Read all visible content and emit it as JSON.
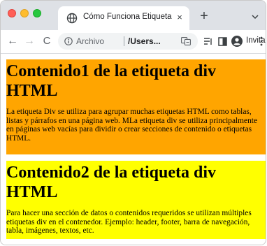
{
  "browser": {
    "tab": {
      "title": "Cómo Funciona Etiqueta DIV",
      "close": "×"
    },
    "new_tab": "+",
    "toolbar": {
      "back": "←",
      "forward": "→",
      "reload": "C",
      "site_info_label": "Archivo",
      "url": "/Users...",
      "profile_label": "Invitado"
    }
  },
  "page": {
    "blocks": [
      {
        "heading": "Contenido1 de la etiqueta div HTML",
        "text": "La etiqueta Div se utiliza para agrupar muchas etiquetas HTML como tablas, listas y párrafos en una página web. MLa etiqueta div se utiliza principalmente en páginas web vacías para dividir o crear secciones de contenido o etiquetas HTML.",
        "background": "#ffa500"
      },
      {
        "heading": "Contenido2 de la etiqueta div HTML",
        "text": "Para hacer una sección de datos o contenidos requeridos se utilizan múltiples etiquetas div en el contenedor. Ejemplo: header, footer, barra de navegación, tabla, imágenes, textos, etc.",
        "background": "#ffff00"
      }
    ]
  },
  "colors": {
    "close": "#ff5f57",
    "minimize": "#febc2e",
    "maximize": "#28c840",
    "tab_strip": "#dee1e6",
    "omnibox": "#f1f3f4"
  },
  "icons": {
    "favicon": "globe-icon",
    "info": "info-icon",
    "translate": "translate-icon",
    "reading_list": "reading-list-icon",
    "side_panel": "side-panel-icon",
    "avatar": "avatar-icon",
    "menu": "kebab-menu-icon",
    "tab_search": "chevron-down-icon"
  }
}
